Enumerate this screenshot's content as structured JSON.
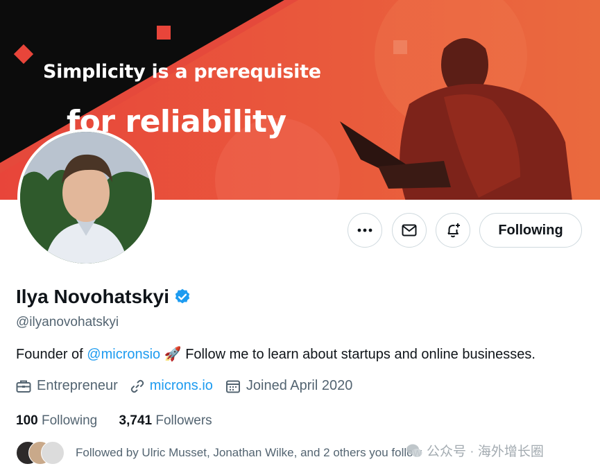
{
  "banner": {
    "line1_a": "Simplicity is a ",
    "line1_b": "prerequisite",
    "line2": "for reliability"
  },
  "profile": {
    "name": "Ilya Novohatskyi",
    "handle": "@ilyanovohatskyi",
    "bio_prefix": "Founder of ",
    "bio_mention": "@micronsio",
    "bio_emoji": "🚀",
    "bio_suffix": " Follow me to learn about startups and online businesses.",
    "profession": "Entrepreneur",
    "website": "microns.io",
    "joined": "Joined April 2020"
  },
  "actions": {
    "more_icon": "more-dots-icon",
    "message_icon": "envelope-icon",
    "notify_icon": "bell-plus-icon",
    "follow_label": "Following"
  },
  "stats": {
    "following_count": "100",
    "following_label": " Following",
    "followers_count": "3,741",
    "followers_label": " Followers"
  },
  "followed_by": "Followed by Ulric Musset, Jonathan Wilke, and 2 others you follow",
  "watermark": "公众号 · 海外增长圈",
  "colors": {
    "accent": "#1d9bf0",
    "banner_red": "#e5493b",
    "secondary_text": "#536471"
  }
}
